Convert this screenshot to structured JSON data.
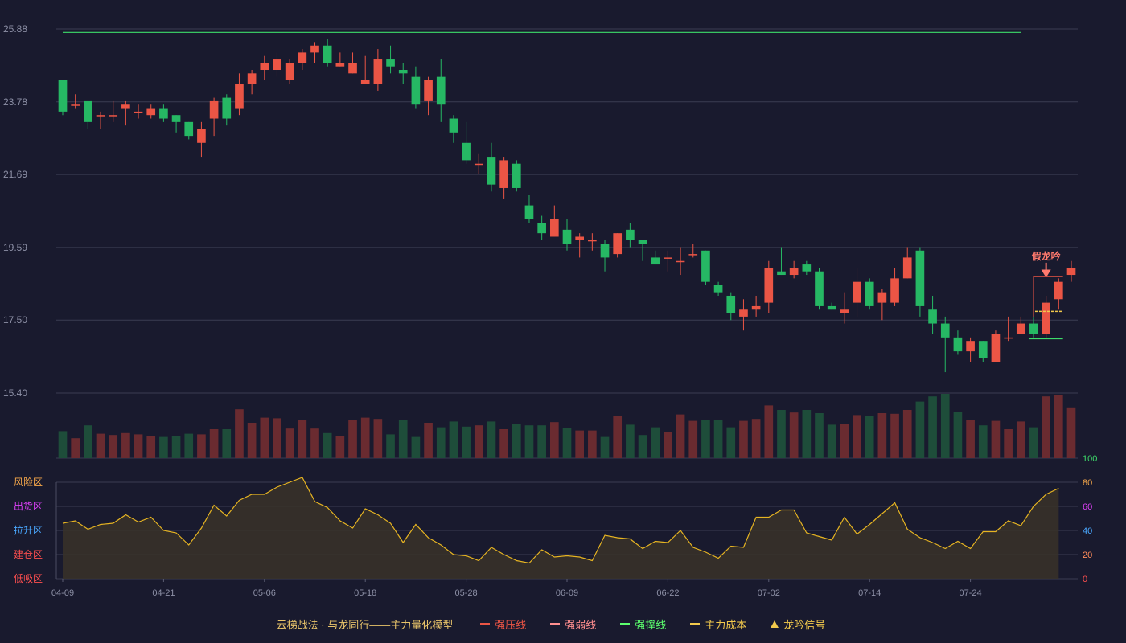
{
  "chart_data": {
    "type": "candlestick",
    "price_axis": {
      "ticks": [
        "25.88",
        "23.78",
        "21.69",
        "19.59",
        "17.50",
        "15.40"
      ],
      "min": 15.4,
      "max": 25.88
    },
    "x_tick_labels": [
      {
        "label": "04-09",
        "index": 0
      },
      {
        "label": "04-21",
        "index": 8
      },
      {
        "label": "05-06",
        "index": 16
      },
      {
        "label": "05-18",
        "index": 24
      },
      {
        "label": "05-28",
        "index": 32
      },
      {
        "label": "06-09",
        "index": 40
      },
      {
        "label": "06-22",
        "index": 48
      },
      {
        "label": "07-02",
        "index": 56
      },
      {
        "label": "07-14",
        "index": 64
      },
      {
        "label": "07-24",
        "index": 72
      }
    ],
    "ohlc": [
      [
        24.4,
        23.5,
        24.4,
        23.4
      ],
      [
        23.7,
        23.7,
        24.0,
        23.6
      ],
      [
        23.8,
        23.2,
        23.8,
        23.0
      ],
      [
        23.4,
        23.4,
        23.5,
        23.0
      ],
      [
        23.4,
        23.4,
        23.8,
        23.2
      ],
      [
        23.6,
        23.7,
        23.8,
        23.1
      ],
      [
        23.5,
        23.5,
        23.7,
        23.3
      ],
      [
        23.4,
        23.6,
        23.7,
        23.3
      ],
      [
        23.6,
        23.3,
        23.7,
        23.2
      ],
      [
        23.4,
        23.2,
        23.4,
        22.9
      ],
      [
        23.2,
        22.8,
        23.2,
        22.7
      ],
      [
        22.6,
        23.0,
        23.2,
        22.2
      ],
      [
        23.3,
        23.8,
        23.9,
        22.8
      ],
      [
        23.9,
        23.3,
        24.0,
        23.1
      ],
      [
        23.6,
        24.3,
        24.6,
        23.4
      ],
      [
        24.3,
        24.6,
        24.7,
        24.0
      ],
      [
        24.7,
        24.9,
        25.1,
        24.4
      ],
      [
        24.7,
        25.0,
        25.2,
        24.5
      ],
      [
        24.4,
        24.9,
        25.0,
        24.3
      ],
      [
        24.9,
        25.2,
        25.3,
        24.7
      ],
      [
        25.2,
        25.4,
        25.5,
        24.9
      ],
      [
        25.4,
        24.9,
        25.6,
        24.8
      ],
      [
        24.8,
        24.9,
        25.2,
        24.8
      ],
      [
        24.6,
        24.9,
        25.2,
        24.6
      ],
      [
        24.3,
        24.4,
        25.1,
        24.3
      ],
      [
        24.3,
        25.0,
        25.3,
        24.1
      ],
      [
        25.0,
        24.8,
        25.4,
        24.6
      ],
      [
        24.7,
        24.6,
        24.9,
        24.3
      ],
      [
        24.5,
        23.7,
        24.8,
        23.6
      ],
      [
        23.8,
        24.4,
        24.5,
        23.4
      ],
      [
        24.5,
        23.7,
        25.0,
        23.2
      ],
      [
        23.3,
        22.9,
        23.4,
        22.6
      ],
      [
        22.6,
        22.1,
        23.2,
        22.0
      ],
      [
        22.0,
        22.0,
        22.3,
        21.7
      ],
      [
        22.2,
        21.4,
        22.6,
        21.2
      ],
      [
        21.3,
        22.1,
        22.2,
        21.0
      ],
      [
        22.0,
        21.3,
        22.1,
        21.2
      ],
      [
        20.8,
        20.4,
        21.1,
        20.3
      ],
      [
        20.3,
        20.0,
        20.5,
        19.8
      ],
      [
        19.9,
        20.4,
        20.8,
        19.9
      ],
      [
        20.1,
        19.7,
        20.4,
        19.5
      ],
      [
        19.8,
        19.9,
        20.0,
        19.3
      ],
      [
        19.8,
        19.8,
        20.0,
        19.5
      ],
      [
        19.7,
        19.3,
        19.8,
        18.9
      ],
      [
        19.4,
        20.0,
        20.0,
        19.3
      ],
      [
        20.1,
        19.8,
        20.3,
        19.6
      ],
      [
        19.8,
        19.7,
        19.8,
        19.2
      ],
      [
        19.3,
        19.1,
        19.5,
        19.1
      ],
      [
        19.3,
        19.3,
        19.5,
        18.9
      ],
      [
        19.2,
        19.2,
        19.6,
        18.8
      ],
      [
        19.4,
        19.4,
        19.7,
        19.3
      ],
      [
        19.5,
        18.6,
        19.5,
        18.5
      ],
      [
        18.5,
        18.3,
        18.6,
        18.2
      ],
      [
        18.2,
        17.7,
        18.3,
        17.5
      ],
      [
        17.6,
        17.8,
        18.1,
        17.2
      ],
      [
        17.8,
        17.9,
        18.2,
        17.6
      ],
      [
        18.0,
        19.0,
        19.2,
        17.7
      ],
      [
        18.9,
        18.8,
        19.6,
        18.8
      ],
      [
        18.8,
        19.0,
        19.2,
        18.7
      ],
      [
        19.1,
        18.9,
        19.2,
        18.8
      ],
      [
        18.9,
        17.9,
        19.0,
        17.8
      ],
      [
        17.9,
        17.8,
        18.0,
        17.8
      ],
      [
        17.7,
        17.8,
        18.3,
        17.4
      ],
      [
        18.0,
        18.6,
        19.0,
        17.6
      ],
      [
        18.6,
        17.9,
        18.7,
        17.8
      ],
      [
        18.0,
        18.3,
        18.4,
        17.5
      ],
      [
        18.0,
        18.7,
        19.0,
        17.9
      ],
      [
        18.7,
        19.3,
        19.6,
        18.7
      ],
      [
        19.5,
        17.9,
        19.6,
        17.6
      ],
      [
        17.8,
        17.4,
        18.2,
        17.1
      ],
      [
        17.4,
        17.0,
        17.6,
        16.0
      ],
      [
        17.0,
        16.6,
        17.2,
        16.5
      ],
      [
        16.6,
        16.9,
        17.0,
        16.3
      ],
      [
        16.9,
        16.4,
        16.9,
        16.3
      ],
      [
        16.3,
        17.1,
        17.2,
        16.3
      ],
      [
        17.0,
        17.0,
        17.6,
        16.9
      ],
      [
        17.1,
        17.4,
        17.6,
        17.1
      ],
      [
        17.4,
        17.1,
        17.8,
        17.0
      ],
      [
        17.1,
        18.0,
        18.2,
        17.0
      ],
      [
        18.1,
        18.6,
        18.7,
        17.8
      ],
      [
        18.8,
        19.0,
        19.2,
        18.6
      ]
    ],
    "volume": [
      42,
      31,
      51,
      38,
      36,
      39,
      37,
      34,
      33,
      34,
      38,
      37,
      45,
      45,
      76,
      55,
      63,
      62,
      46,
      60,
      46,
      39,
      35,
      60,
      63,
      61,
      37,
      59,
      33,
      55,
      48,
      57,
      49,
      51,
      57,
      45,
      53,
      51,
      51,
      56,
      47,
      43,
      43,
      33,
      65,
      52,
      36,
      48,
      40,
      68,
      58,
      59,
      60,
      48,
      58,
      61,
      82,
      75,
      71,
      75,
      70,
      52,
      53,
      67,
      65,
      70,
      69,
      75,
      88,
      96,
      100,
      72,
      59,
      51,
      58,
      45,
      57,
      48,
      96,
      98,
      79
    ],
    "oscillator": {
      "range": [
        0,
        100
      ],
      "ticks": [
        "0",
        "20",
        "40",
        "60",
        "80",
        "100"
      ],
      "zones": [
        "低吸区",
        "建仓区",
        "拉升区",
        "出货区",
        "风险区"
      ],
      "values": [
        46,
        48,
        41,
        45,
        46,
        53,
        47,
        51,
        40,
        38,
        28,
        42,
        61,
        52,
        65,
        70,
        70,
        76,
        80,
        84,
        64,
        59,
        48,
        42,
        58,
        53,
        46,
        30,
        45,
        34,
        28,
        20,
        19,
        15,
        26,
        20,
        15,
        13,
        24,
        18,
        19,
        18,
        15,
        36,
        34,
        33,
        25,
        31,
        30,
        40,
        26,
        22,
        17,
        27,
        26,
        51,
        51,
        57,
        57,
        38,
        35,
        32,
        51,
        37,
        45,
        54,
        63,
        41,
        34,
        30,
        25,
        31,
        25,
        39,
        39,
        48,
        44,
        60,
        70,
        75
      ]
    },
    "strong_resistance": {
      "value": 25.78,
      "from_index": 0,
      "to_index": 76
    },
    "strong_support": {
      "value": 16.96,
      "from_index": 77,
      "to_index": 79
    },
    "main_cost": {
      "value": 17.75,
      "from_index": 77,
      "to_index": 79
    },
    "signal": {
      "label": "假龙吟",
      "index": 78
    },
    "colors": {
      "up": "#eb5545",
      "down": "#26b864",
      "vol_up": "#6a2b30",
      "vol_down": "#1e4d3a",
      "osc_line": "#e6b422",
      "support": "#3ddc6a",
      "cost": "#f2c94c",
      "resistance": "#eb5545",
      "weak": "#ff8f8f",
      "signal": "#f2c94c",
      "signal_text": "#ff7a6e"
    }
  },
  "legend": {
    "title": "云梯战法 · 与龙同行——主力量化模型",
    "items": [
      {
        "label": "强压线",
        "color": "#eb5545",
        "style": "solid"
      },
      {
        "label": "强弱线",
        "color": "#ff8f8f",
        "style": "dashed"
      },
      {
        "label": "强撑线",
        "color": "#5cff6e",
        "style": "solid"
      },
      {
        "label": "主力成本",
        "color": "#f2c94c",
        "style": "dashed"
      },
      {
        "label": "龙吟信号",
        "color": "#f2c94c",
        "style": "triangle"
      }
    ],
    "zone_colors": [
      "#ff4f4f",
      "#ff4f4f",
      "#4aa8ff",
      "#e040fb",
      "#f7a84a"
    ],
    "osc_tick_colors": [
      "#ff4f4f",
      "#ff8c5a",
      "#4aa8ff",
      "#e040fb",
      "#f7a84a",
      "#3ddc6a"
    ]
  }
}
